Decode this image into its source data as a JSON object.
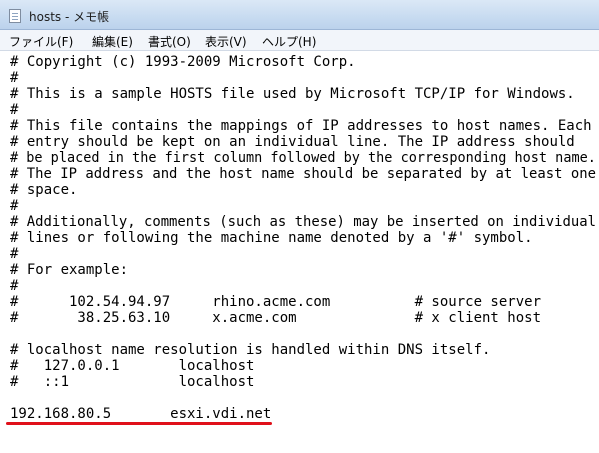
{
  "window": {
    "title": "hosts - メモ帳"
  },
  "menu": {
    "file": "ファイル(F)",
    "edit": "編集(E)",
    "format": "書式(O)",
    "view": "表示(V)",
    "help": "ヘルプ(H)"
  },
  "content": {
    "lines": [
      "# Copyright (c) 1993-2009 Microsoft Corp.",
      "#",
      "# This is a sample HOSTS file used by Microsoft TCP/IP for Windows.",
      "#",
      "# This file contains the mappings of IP addresses to host names. Each",
      "# entry should be kept on an individual line. The IP address should",
      "# be placed in the first column followed by the corresponding host name.",
      "# The IP address and the host name should be separated by at least one",
      "# space.",
      "#",
      "# Additionally, comments (such as these) may be inserted on individual",
      "# lines or following the machine name denoted by a '#' symbol.",
      "#",
      "# For example:",
      "#",
      "#      102.54.94.97     rhino.acme.com          # source server",
      "#       38.25.63.10     x.acme.com              # x client host",
      "",
      "# localhost name resolution is handled within DNS itself.",
      "#   127.0.0.1       localhost",
      "#   ::1             localhost",
      "",
      "192.168.80.5       esxi.vdi.net"
    ]
  },
  "highlight": {
    "color": "#e0101a"
  }
}
